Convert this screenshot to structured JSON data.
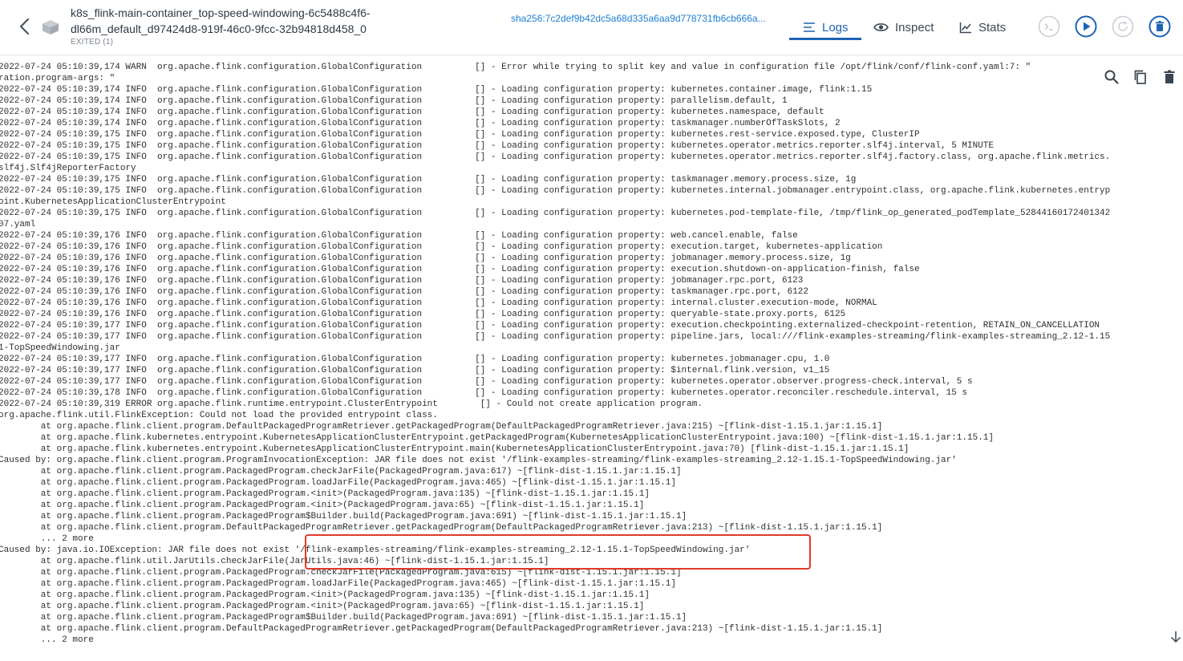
{
  "header": {
    "title": "k8s_flink-main-container_top-speed-windowing-6c5488c4f6-dl66m_default_d97424d8-919f-46c0-9fcc-32b94818d458_0",
    "status": "EXITED (1)",
    "sha": "sha256:7c2def9b42dc5a68d335a6aa9d778731fb6cb666a..."
  },
  "tabs": [
    {
      "label": "Logs",
      "icon": "list-icon",
      "active": true
    },
    {
      "label": "Inspect",
      "icon": "eye-icon"
    },
    {
      "label": "Stats",
      "icon": "chart-icon"
    }
  ],
  "controls": [
    "terminal-icon",
    "play-icon",
    "restart-icon",
    "delete-icon"
  ],
  "log_tools": [
    "search-icon",
    "copy-icon",
    "trash-icon"
  ],
  "colors": {
    "accent": "#1d63b6",
    "highlight": "#e03a2a"
  },
  "log": {
    "lines": [
      "2022-07-24 05:10:39,174 WARN  org.apache.flink.configuration.GlobalConfiguration          [] - Error while trying to split key and value in configuration file /opt/flink/conf/flink-conf.yaml:7: \"",
      "ration.program-args: \"",
      "2022-07-24 05:10:39,174 INFO  org.apache.flink.configuration.GlobalConfiguration          [] - Loading configuration property: kubernetes.container.image, flink:1.15",
      "2022-07-24 05:10:39,174 INFO  org.apache.flink.configuration.GlobalConfiguration          [] - Loading configuration property: parallelism.default, 1",
      "2022-07-24 05:10:39,174 INFO  org.apache.flink.configuration.GlobalConfiguration          [] - Loading configuration property: kubernetes.namespace, default",
      "2022-07-24 05:10:39,174 INFO  org.apache.flink.configuration.GlobalConfiguration          [] - Loading configuration property: taskmanager.numberOfTaskSlots, 2",
      "2022-07-24 05:10:39,175 INFO  org.apache.flink.configuration.GlobalConfiguration          [] - Loading configuration property: kubernetes.rest-service.exposed.type, ClusterIP",
      "2022-07-24 05:10:39,175 INFO  org.apache.flink.configuration.GlobalConfiguration          [] - Loading configuration property: kubernetes.operator.metrics.reporter.slf4j.interval, 5 MINUTE",
      "2022-07-24 05:10:39,175 INFO  org.apache.flink.configuration.GlobalConfiguration          [] - Loading configuration property: kubernetes.operator.metrics.reporter.slf4j.factory.class, org.apache.flink.metrics.",
      "slf4j.Slf4jReporterFactory",
      "2022-07-24 05:10:39,175 INFO  org.apache.flink.configuration.GlobalConfiguration          [] - Loading configuration property: taskmanager.memory.process.size, 1g",
      "2022-07-24 05:10:39,175 INFO  org.apache.flink.configuration.GlobalConfiguration          [] - Loading configuration property: kubernetes.internal.jobmanager.entrypoint.class, org.apache.flink.kubernetes.entryp",
      "oint.KubernetesApplicationClusterEntrypoint",
      "2022-07-24 05:10:39,175 INFO  org.apache.flink.configuration.GlobalConfiguration          [] - Loading configuration property: kubernetes.pod-template-file, /tmp/flink_op_generated_podTemplate_52844160172401342",
      "07.yaml",
      "2022-07-24 05:10:39,176 INFO  org.apache.flink.configuration.GlobalConfiguration          [] - Loading configuration property: web.cancel.enable, false",
      "2022-07-24 05:10:39,176 INFO  org.apache.flink.configuration.GlobalConfiguration          [] - Loading configuration property: execution.target, kubernetes-application",
      "2022-07-24 05:10:39,176 INFO  org.apache.flink.configuration.GlobalConfiguration          [] - Loading configuration property: jobmanager.memory.process.size, 1g",
      "2022-07-24 05:10:39,176 INFO  org.apache.flink.configuration.GlobalConfiguration          [] - Loading configuration property: execution.shutdown-on-application-finish, false",
      "2022-07-24 05:10:39,176 INFO  org.apache.flink.configuration.GlobalConfiguration          [] - Loading configuration property: jobmanager.rpc.port, 6123",
      "2022-07-24 05:10:39,176 INFO  org.apache.flink.configuration.GlobalConfiguration          [] - Loading configuration property: taskmanager.rpc.port, 6122",
      "2022-07-24 05:10:39,176 INFO  org.apache.flink.configuration.GlobalConfiguration          [] - Loading configuration property: internal.cluster.execution-mode, NORMAL",
      "2022-07-24 05:10:39,176 INFO  org.apache.flink.configuration.GlobalConfiguration          [] - Loading configuration property: queryable-state.proxy.ports, 6125",
      "2022-07-24 05:10:39,177 INFO  org.apache.flink.configuration.GlobalConfiguration          [] - Loading configuration property: execution.checkpointing.externalized-checkpoint-retention, RETAIN_ON_CANCELLATION",
      "2022-07-24 05:10:39,177 INFO  org.apache.flink.configuration.GlobalConfiguration          [] - Loading configuration property: pipeline.jars, local:///flink-examples-streaming/flink-examples-streaming_2.12-1.15",
      "1-TopSpeedWindowing.jar",
      "2022-07-24 05:10:39,177 INFO  org.apache.flink.configuration.GlobalConfiguration          [] - Loading configuration property: kubernetes.jobmanager.cpu, 1.0",
      "2022-07-24 05:10:39,177 INFO  org.apache.flink.configuration.GlobalConfiguration          [] - Loading configuration property: $internal.flink.version, v1_15",
      "2022-07-24 05:10:39,177 INFO  org.apache.flink.configuration.GlobalConfiguration          [] - Loading configuration property: kubernetes.operator.observer.progress-check.interval, 5 s",
      "2022-07-24 05:10:39,178 INFO  org.apache.flink.configuration.GlobalConfiguration          [] - Loading configuration property: kubernetes.operator.reconciler.reschedule.interval, 15 s",
      "2022-07-24 05:10:39,319 ERROR org.apache.flink.runtime.entrypoint.ClusterEntrypoint        [] - Could not create application program.",
      "org.apache.flink.util.FlinkException: Could not load the provided entrypoint class.",
      "        at org.apache.flink.client.program.DefaultPackagedProgramRetriever.getPackagedProgram(DefaultPackagedProgramRetriever.java:215) ~[flink-dist-1.15.1.jar:1.15.1]",
      "        at org.apache.flink.kubernetes.entrypoint.KubernetesApplicationClusterEntrypoint.getPackagedProgram(KubernetesApplicationClusterEntrypoint.java:100) ~[flink-dist-1.15.1.jar:1.15.1]",
      "        at org.apache.flink.kubernetes.entrypoint.KubernetesApplicationClusterEntrypoint.main(KubernetesApplicationClusterEntrypoint.java:70) [flink-dist-1.15.1.jar:1.15.1]",
      "Caused by: org.apache.flink.client.program.ProgramInvocationException: JAR file does not exist '/flink-examples-streaming/flink-examples-streaming_2.12-1.15.1-TopSpeedWindowing.jar'",
      "        at org.apache.flink.client.program.PackagedProgram.checkJarFile(PackagedProgram.java:617) ~[flink-dist-1.15.1.jar:1.15.1]",
      "        at org.apache.flink.client.program.PackagedProgram.loadJarFile(PackagedProgram.java:465) ~[flink-dist-1.15.1.jar:1.15.1]",
      "        at org.apache.flink.client.program.PackagedProgram.<init>(PackagedProgram.java:135) ~[flink-dist-1.15.1.jar:1.15.1]",
      "        at org.apache.flink.client.program.PackagedProgram.<init>(PackagedProgram.java:65) ~[flink-dist-1.15.1.jar:1.15.1]",
      "        at org.apache.flink.client.program.PackagedProgram$Builder.build(PackagedProgram.java:691) ~[flink-dist-1.15.1.jar:1.15.1]",
      "        at org.apache.flink.client.program.DefaultPackagedProgramRetriever.getPackagedProgram(DefaultPackagedProgramRetriever.java:213) ~[flink-dist-1.15.1.jar:1.15.1]",
      "        ... 2 more",
      "Caused by: java.io.IOException: JAR file does not exist '/flink-examples-streaming/flink-examples-streaming_2.12-1.15.1-TopSpeedWindowing.jar'",
      "        at org.apache.flink.util.JarUtils.checkJarFile(JarUtils.java:46) ~[flink-dist-1.15.1.jar:1.15.1]",
      "        at org.apache.flink.client.program.PackagedProgram.checkJarFile(PackagedProgram.java:615) ~[flink-dist-1.15.1.jar:1.15.1]",
      "        at org.apache.flink.client.program.PackagedProgram.loadJarFile(PackagedProgram.java:465) ~[flink-dist-1.15.1.jar:1.15.1]",
      "        at org.apache.flink.client.program.PackagedProgram.<init>(PackagedProgram.java:135) ~[flink-dist-1.15.1.jar:1.15.1]",
      "        at org.apache.flink.client.program.PackagedProgram.<init>(PackagedProgram.java:65) ~[flink-dist-1.15.1.jar:1.15.1]",
      "        at org.apache.flink.client.program.PackagedProgram$Builder.build(PackagedProgram.java:691) ~[flink-dist-1.15.1.jar:1.15.1]",
      "        at org.apache.flink.client.program.DefaultPackagedProgramRetriever.getPackagedProgram(DefaultPackagedProgramRetriever.java:213) ~[flink-dist-1.15.1.jar:1.15.1]",
      "        ... 2 more"
    ]
  }
}
